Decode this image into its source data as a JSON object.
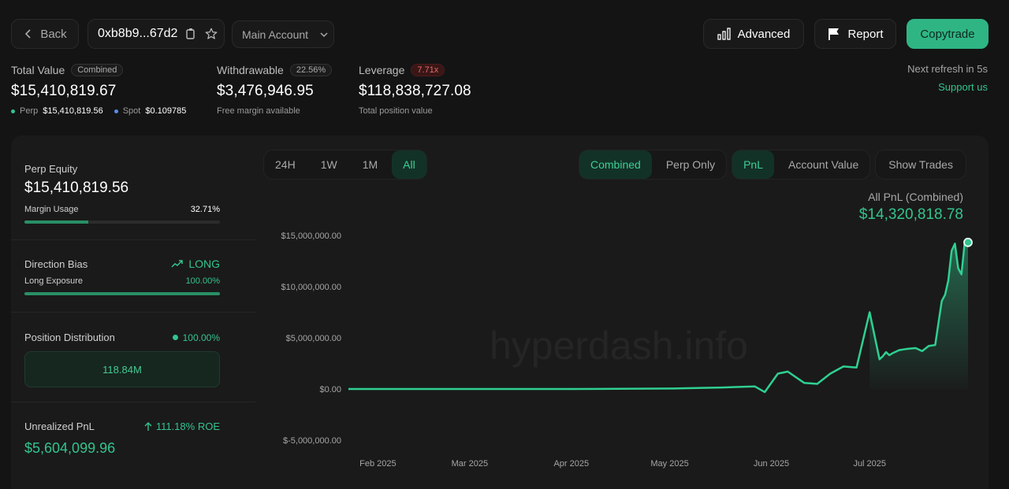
{
  "header": {
    "back_label": "Back",
    "address": "0xb8b9...67d2",
    "account_select": "Main Account",
    "advanced_label": "Advanced",
    "report_label": "Report",
    "copytrade_label": "Copytrade"
  },
  "summary": {
    "total_value": {
      "label": "Total Value",
      "badge": "Combined",
      "value": "$15,410,819.67",
      "perp_label": "Perp",
      "perp_value": "$15,410,819.56",
      "spot_label": "Spot",
      "spot_value": "$0.109785"
    },
    "withdrawable": {
      "label": "Withdrawable",
      "badge": "22.56%",
      "value": "$3,476,946.95",
      "sub": "Free margin available"
    },
    "leverage": {
      "label": "Leverage",
      "badge": "7.71x",
      "value": "$118,838,727.08",
      "sub": "Total position value"
    },
    "refresh": "Next refresh in 5s",
    "support": "Support us"
  },
  "left": {
    "perp_equity": {
      "label": "Perp Equity",
      "value": "$15,410,819.56",
      "margin_label": "Margin Usage",
      "margin_value": "32.71%",
      "margin_fraction": 0.3271
    },
    "direction": {
      "label": "Direction Bias",
      "bias": "LONG",
      "exposure_label": "Long Exposure",
      "exposure_value": "100.00%",
      "exposure_fraction": 1.0
    },
    "distribution": {
      "label": "Position Distribution",
      "value": "100.00%",
      "box_value": "118.84M"
    },
    "unrealized": {
      "label": "Unrealized PnL",
      "roe": "111.18% ROE",
      "value": "$5,604,099.96"
    }
  },
  "chart_controls": {
    "ranges": [
      "24H",
      "1W",
      "1M",
      "All"
    ],
    "active_range": "All",
    "mode": [
      "Combined",
      "Perp Only"
    ],
    "metric": [
      "PnL",
      "Account Value"
    ],
    "show_trades": "Show Trades"
  },
  "chart_header": {
    "title": "All PnL (Combined)",
    "value": "$14,320,818.78"
  },
  "watermark": "hyperdash.info",
  "colors": {
    "accent": "#33c48d",
    "negative": "#e06a6a",
    "spot_dot": "#5b8de6"
  },
  "chart_data": {
    "type": "area",
    "y_tick_labels": [
      "$15,000,000.00",
      "$10,000,000.00",
      "$5,000,000.00",
      "$0.00",
      "$-5,000,000.00"
    ],
    "y_ticks": [
      15000000,
      10000000,
      5000000,
      0,
      -5000000
    ],
    "ylim": [
      -5000000,
      15000000
    ],
    "x_tick_labels": [
      "Feb 2025",
      "Mar 2025",
      "Apr 2025",
      "May 2025",
      "Jun 2025",
      "Jul 2025"
    ],
    "x_ticks": [
      0,
      28,
      59,
      89,
      120,
      150
    ],
    "xlim": [
      -9,
      180
    ],
    "series": [
      {
        "x": [
          -9,
          0,
          30,
          60,
          90,
          105,
          110,
          115,
          118,
          122,
          125,
          130,
          134,
          138,
          142,
          146,
          150,
          153,
          154,
          155,
          156,
          157,
          159,
          161,
          164,
          166,
          168,
          170,
          171,
          172,
          173,
          174,
          175,
          176,
          177,
          178,
          179,
          180
        ],
        "y": [
          0,
          0,
          0,
          0,
          50000,
          150000,
          200000,
          250000,
          -300000,
          1500000,
          1700000,
          600000,
          500000,
          1500000,
          2200000,
          2100000,
          7500000,
          2900000,
          3200000,
          3600000,
          3300000,
          3500000,
          3800000,
          3900000,
          4000000,
          3700000,
          4200000,
          4300000,
          6500000,
          8600000,
          9200000,
          10600000,
          13500000,
          14200000,
          11800000,
          11200000,
          14300000,
          14320818
        ]
      }
    ]
  }
}
